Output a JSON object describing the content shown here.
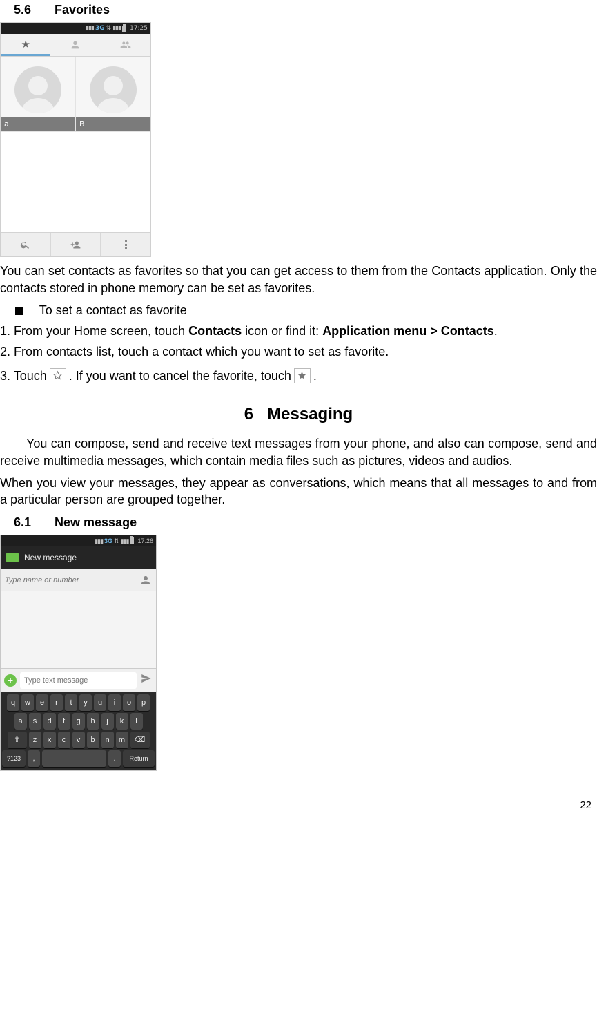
{
  "page_number": "22",
  "sec56": {
    "num": "5.6",
    "title": "Favorites"
  },
  "phone1": {
    "statusbar": {
      "network": "3G",
      "time": "17:25"
    },
    "tabs": {
      "star": "★",
      "person": "person",
      "group": "group"
    },
    "cards": [
      {
        "name": "a"
      },
      {
        "name": "B"
      }
    ]
  },
  "para_fav_intro": "You can set contacts as favorites so that you can get access to them from the Contacts application. Only the contacts stored in phone memory can be set as favorites.",
  "bullet_setfav": "To set a contact as favorite",
  "step1": {
    "prefix": "1. From your Home screen, touch ",
    "bold1": "Contacts",
    "mid": " icon or find it: ",
    "bold2": "Application menu > Contacts",
    "suffix": "."
  },
  "step2": "2. From contacts list, touch a contact which you want to set as favorite.",
  "step3": {
    "a": "3. Touch ",
    "b": ". If you want to cancel the favorite, touch ",
    "c": "."
  },
  "chapter6": {
    "num": "6",
    "title": "Messaging"
  },
  "para_msg1": "You can compose, send and receive text messages from your phone, and also can compose, send and receive multimedia messages, which contain media files such as pictures, videos and audios.",
  "para_msg2": "When you view your messages, they appear as conversations, which means that all messages to and from a particular person are grouped together.",
  "sec61": {
    "num": "6.1",
    "title": "New message"
  },
  "phone2": {
    "statusbar": {
      "network": "3G",
      "time": "17:26"
    },
    "header": "New message",
    "recipient_placeholder": "Type name or number",
    "compose_placeholder": "Type text message",
    "keyboard": {
      "row1": [
        "q",
        "w",
        "e",
        "r",
        "t",
        "y",
        "u",
        "i",
        "o",
        "p"
      ],
      "row2": [
        "a",
        "s",
        "d",
        "f",
        "g",
        "h",
        "j",
        "k",
        "l"
      ],
      "row3_shift": "⇧",
      "row3": [
        "z",
        "x",
        "c",
        "v",
        "b",
        "n",
        "m"
      ],
      "row3_back": "⌫",
      "row4_sym": "?123",
      "row4_comma": ",",
      "row4_dot": ".",
      "row4_return": "Return"
    }
  }
}
